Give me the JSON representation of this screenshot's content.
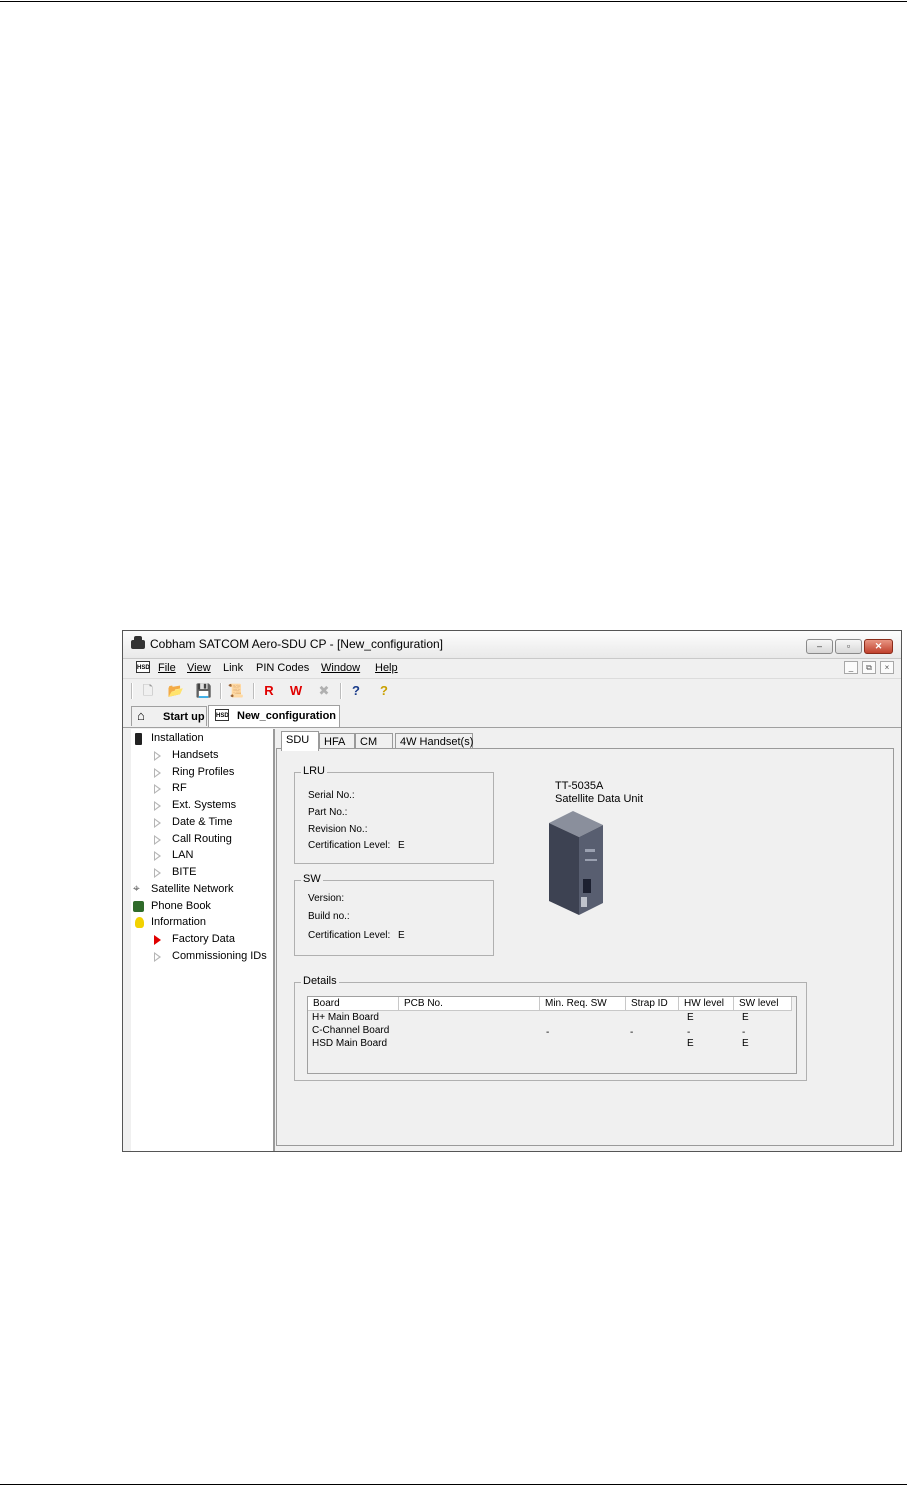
{
  "window": {
    "title": "Cobham SATCOM Aero-SDU CP - [New_configuration]",
    "controls": {
      "minimize": "‒",
      "maximize": "▫",
      "close": "✕"
    },
    "mdi_controls": {
      "minimize": "_",
      "restore": "⧉",
      "close": "×"
    }
  },
  "menu": {
    "doc_icon": "HSD",
    "items": [
      "File",
      "View",
      "Link",
      "PIN Codes",
      "Window",
      "Help"
    ]
  },
  "toolbar": {
    "buttons": [
      {
        "icon": "new-document-icon",
        "glyph": "🗋"
      },
      {
        "icon": "open-folder-icon",
        "glyph": "📂"
      },
      {
        "icon": "save-disk-icon",
        "glyph": "💾"
      },
      {
        "icon": "scroll-icon",
        "glyph": "📜"
      },
      {
        "icon": "read-icon",
        "glyph": "R",
        "color": "#e00000"
      },
      {
        "icon": "write-icon",
        "glyph": "W",
        "color": "#e00000"
      },
      {
        "icon": "cancel-icon",
        "glyph": "✖"
      },
      {
        "icon": "context-help-icon",
        "glyph": "?"
      },
      {
        "icon": "help-icon",
        "glyph": "?"
      }
    ]
  },
  "page_tabs": {
    "startup": "Start up",
    "config": "New_configuration",
    "config_icon": "HSD"
  },
  "tree": {
    "installation": "Installation",
    "installation_children": [
      "Handsets",
      "Ring Profiles",
      "RF",
      "Ext. Systems",
      "Date & Time",
      "Call Routing",
      "LAN",
      "BITE"
    ],
    "satellite_network": "Satellite Network",
    "phone_book": "Phone Book",
    "information": "Information",
    "information_children": [
      "Factory Data",
      "Commissioning IDs"
    ],
    "selected": "Factory Data"
  },
  "content_tabs": [
    "SDU",
    "HFA",
    "CM",
    "4W Handset(s)"
  ],
  "lru": {
    "legend": "LRU",
    "serial_label": "Serial No.:",
    "part_label": "Part No.:",
    "revision_label": "Revision No.:",
    "cert_label": "Certification Level:",
    "cert_value": "E"
  },
  "sw": {
    "legend": "SW",
    "version_label": "Version:",
    "build_label": "Build no.:",
    "cert_label": "Certification Level:",
    "cert_value": "E"
  },
  "unit": {
    "model": "TT-5035A",
    "name": "Satellite Data Unit"
  },
  "details": {
    "legend": "Details",
    "columns": [
      "Board",
      "PCB No.",
      "Min. Req. SW",
      "Strap ID",
      "HW level",
      "SW level"
    ],
    "rows": [
      [
        "H+ Main Board",
        "",
        "",
        "",
        "E",
        "E"
      ],
      [
        "C-Channel Board",
        "",
        "-",
        "-",
        "-",
        "-"
      ],
      [
        "HSD Main Board",
        "",
        "",
        "",
        "E",
        "E"
      ]
    ]
  },
  "colors": {
    "accent_red": "#e00000",
    "window_bg": "#f0f0f0",
    "close_button": "#c0412d"
  }
}
